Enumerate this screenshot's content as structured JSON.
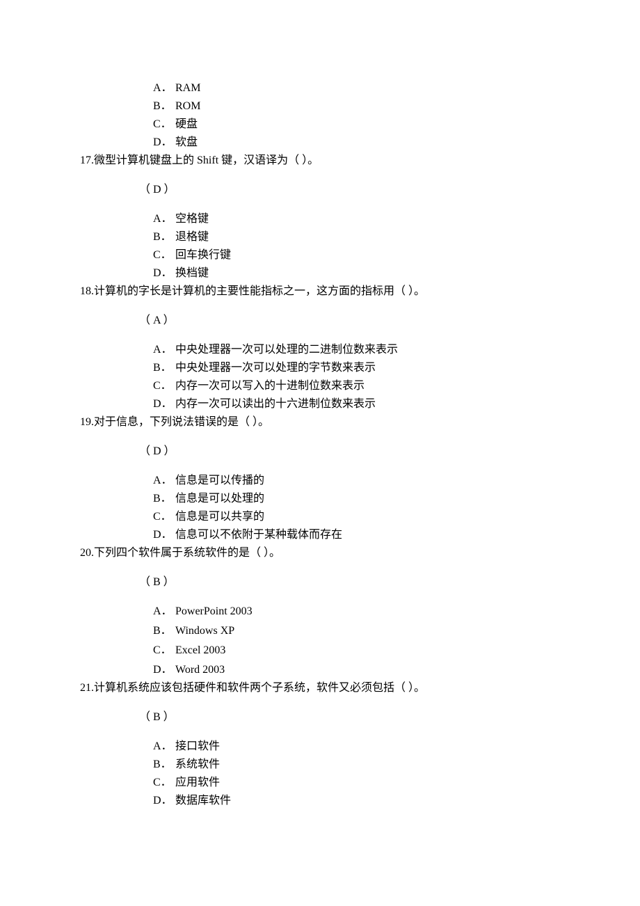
{
  "q16_options": {
    "A": {
      "letter": "A．",
      "text": "RAM"
    },
    "B": {
      "letter": "B．",
      "text": "ROM"
    },
    "C": {
      "letter": "C．",
      "text": "硬盘"
    },
    "D": {
      "letter": "D．",
      "text": "软盘"
    }
  },
  "q17": {
    "num": "17.",
    "text_pre": "微型计算机键盘上的 ",
    "text_en": "Shift",
    "text_post": " 键，汉语译为（ ）。",
    "answer": "（ D ）",
    "options": {
      "A": {
        "letter": "A．",
        "text": "空格键"
      },
      "B": {
        "letter": "B．",
        "text": "退格键"
      },
      "C": {
        "letter": "C．",
        "text": "回车换行键"
      },
      "D": {
        "letter": "D．",
        "text": "换档键"
      }
    }
  },
  "q18": {
    "num": "18.",
    "text": "计算机的字长是计算机的主要性能指标之一，这方面的指标用（ ）。",
    "answer": "（ A ）",
    "options": {
      "A": {
        "letter": "A．",
        "text": "中央处理器一次可以处理的二进制位数来表示"
      },
      "B": {
        "letter": "B．",
        "text": "中央处理器一次可以处理的字节数来表示"
      },
      "C": {
        "letter": "C．",
        "text": "内存一次可以写入的十进制位数来表示"
      },
      "D": {
        "letter": "D．",
        "text": "内存一次可以读出的十六进制位数来表示"
      }
    }
  },
  "q19": {
    "num": "19.",
    "text": "对于信息，下列说法错误的是（ ）。",
    "answer": "（ D ）",
    "options": {
      "A": {
        "letter": "A．",
        "text": "信息是可以传播的"
      },
      "B": {
        "letter": "B．",
        "text": "信息是可以处理的"
      },
      "C": {
        "letter": "C．",
        "text": "信息是可以共享的"
      },
      "D": {
        "letter": "D．",
        "text": "信息可以不依附于某种载体而存在"
      }
    }
  },
  "q20": {
    "num": "20.",
    "text": "下列四个软件属于系统软件的是（ ）。",
    "answer": "（ B ）",
    "options": {
      "A": {
        "letter": "A．",
        "text": "PowerPoint 2003"
      },
      "B": {
        "letter": "B．",
        "text": "Windows XP"
      },
      "C": {
        "letter": "C．",
        "text": "Excel 2003"
      },
      "D": {
        "letter": "D．",
        "text": "Word 2003"
      }
    }
  },
  "q21": {
    "num": "21.",
    "text": "计算机系统应该包括硬件和软件两个子系统，软件又必须包括（ ）。",
    "answer": "（ B ）",
    "options": {
      "A": {
        "letter": "A．",
        "text": "接口软件"
      },
      "B": {
        "letter": "B．",
        "text": "系统软件"
      },
      "C": {
        "letter": "C．",
        "text": "应用软件"
      },
      "D": {
        "letter": "D．",
        "text": "数据库软件"
      }
    }
  }
}
